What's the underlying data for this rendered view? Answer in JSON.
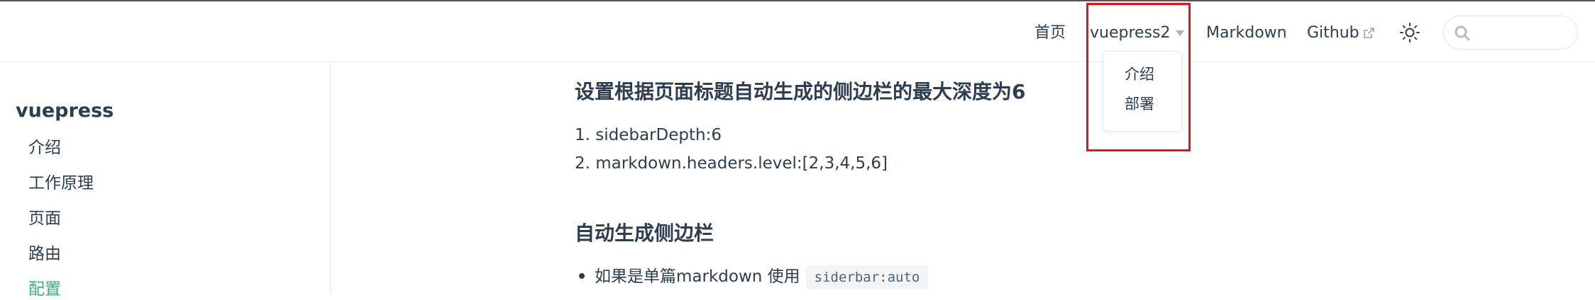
{
  "navbar": {
    "home": "首页",
    "dropdown_label": "vuepress2",
    "markdown": "Markdown",
    "github": "Github",
    "search_placeholder": ""
  },
  "dropdown": {
    "items": [
      "介绍",
      "部署"
    ]
  },
  "sidebar": {
    "title": "vuepress",
    "items": [
      {
        "label": "介绍"
      },
      {
        "label": "工作原理"
      },
      {
        "label": "页面"
      },
      {
        "label": "路由"
      },
      {
        "label": "配置"
      }
    ],
    "active_color": "#3eaf7c"
  },
  "content": {
    "heading1": "设置根据页面标题自动生成的侧边栏的最大深度为6",
    "ordered_list": [
      "1. sidebarDepth:6",
      "2. markdown.headers.level:[2,3,4,5,6]"
    ],
    "heading2": "自动生成侧边栏",
    "bullet_text": "如果是单篇markdown 使用",
    "bullet_code": "siderbar:auto"
  },
  "colors": {
    "text": "#2c3e50",
    "accent": "#3eaf7c",
    "highlight": "#e0161f"
  }
}
